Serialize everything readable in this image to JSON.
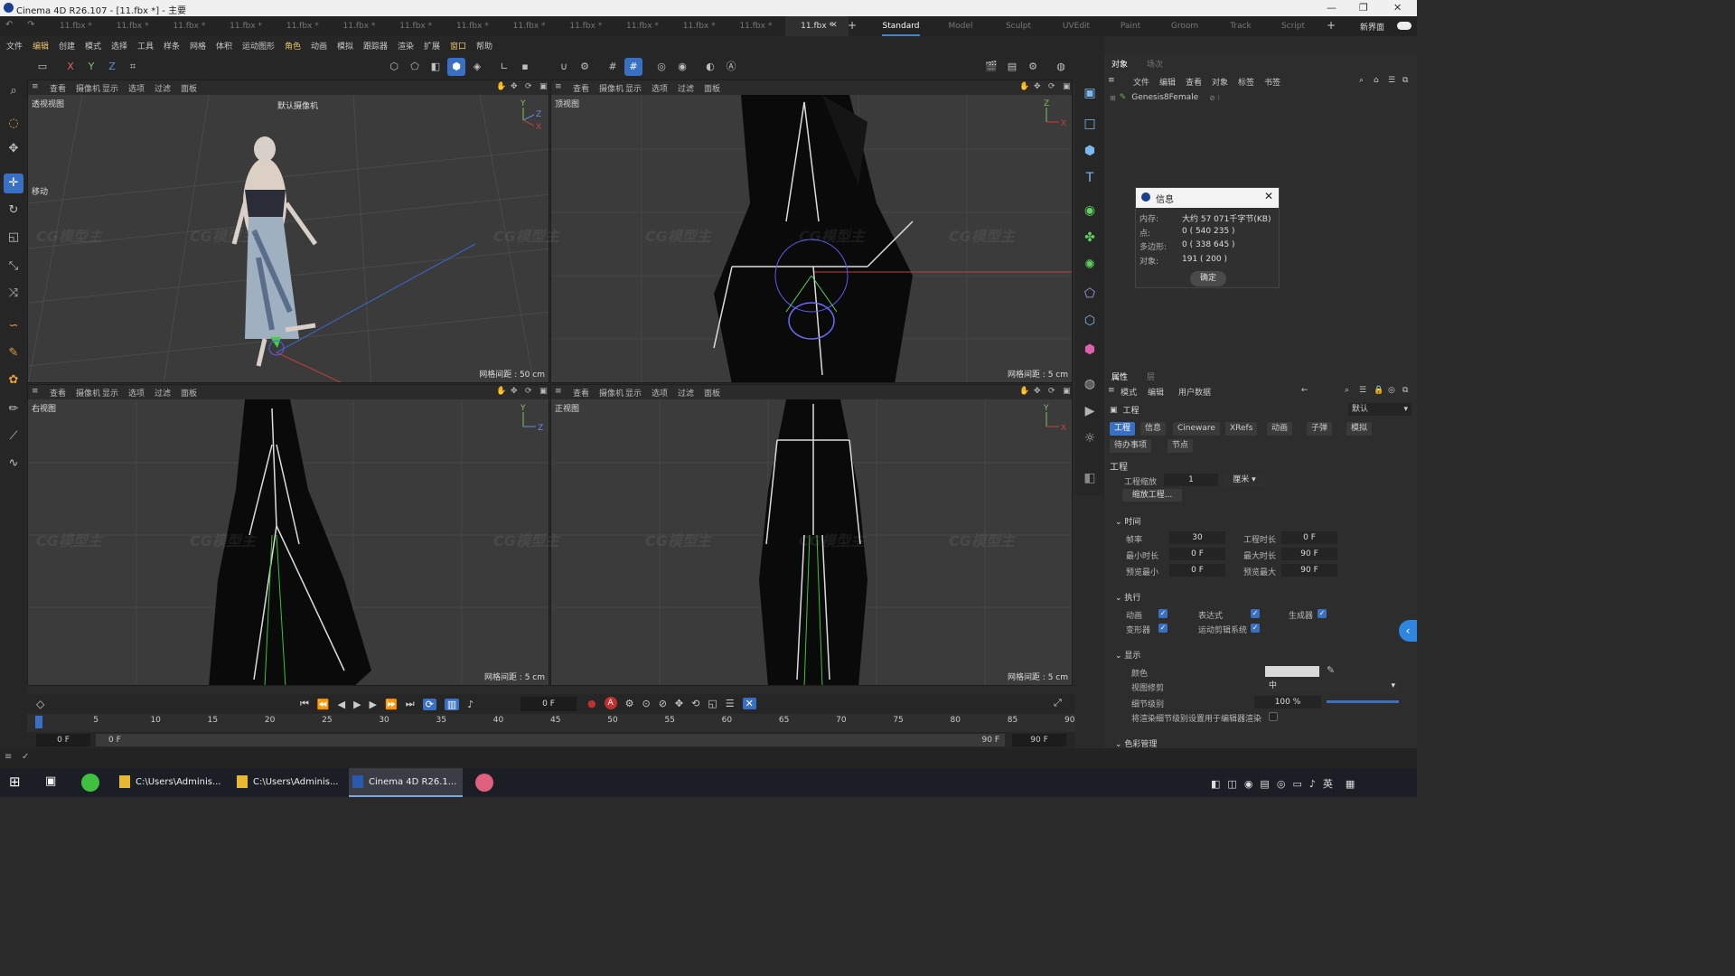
{
  "window": {
    "title": "Cinema 4D R26.107 - [11.fbx *] - 主要",
    "controls": [
      "—",
      "❐",
      "✕"
    ]
  },
  "doc_tabs": [
    "11.fbx *",
    "11.fbx *",
    "11.fbx *",
    "11.fbx *",
    "11.fbx *",
    "11.fbx *",
    "11.fbx *",
    "11.fbx *",
    "11.fbx *",
    "11.fbx *",
    "11.fbx *",
    "11.fbx *",
    "11.fbx *",
    "11.fbx *"
  ],
  "active_doc_tab": "11.fbx *",
  "layout_tabs": [
    "Standard",
    "Model",
    "Sculpt",
    "UVEdit",
    "Paint",
    "Groom",
    "Track",
    "Script"
  ],
  "active_layout": "Standard",
  "new_layout_label": "新界面",
  "menu": [
    "文件",
    "编辑",
    "创建",
    "模式",
    "选择",
    "工具",
    "样条",
    "网格",
    "体积",
    "运动图形",
    "角色",
    "动画",
    "模拟",
    "跟踪器",
    "渲染",
    "扩展",
    "窗口",
    "帮助"
  ],
  "toolbar_axes": [
    "X",
    "Y",
    "Z"
  ],
  "viewport_menu": [
    "查看",
    "摄像机",
    "显示",
    "选项",
    "过滤",
    "面板"
  ],
  "viewports": [
    {
      "title": "透视视图",
      "grid": "网格间距 : 50 cm",
      "camera": "默认摄像机",
      "move_label": "移动"
    },
    {
      "title": "顶视图",
      "grid": "网格间距 : 5 cm"
    },
    {
      "title": "右视图",
      "grid": "网格间距 : 5 cm"
    },
    {
      "title": "正视图",
      "grid": "网格间距 : 5 cm"
    }
  ],
  "object_panel": {
    "tabs": [
      "对象",
      "场次"
    ],
    "menu": [
      "文件",
      "编辑",
      "查看",
      "对象",
      "标签",
      "书签"
    ],
    "object": "Genesis8Female"
  },
  "info_dialog": {
    "title": "信息",
    "rows": [
      {
        "k": "内存:",
        "v": "大约 57 071千字节(KB)"
      },
      {
        "k": "点:",
        "v": "0 ( 540 235 )"
      },
      {
        "k": "多边形:",
        "v": "0 ( 338 645 )"
      },
      {
        "k": "对象:",
        "v": "191 ( 200 )"
      }
    ],
    "ok": "确定"
  },
  "attr_panel": {
    "tabs": [
      "属性",
      "层"
    ],
    "menu": [
      "模式",
      "编辑",
      "用户数据"
    ],
    "header": "工程",
    "preset": "默认",
    "subtabs": [
      "工程",
      "信息",
      "Cineware",
      "XRefs",
      "动画",
      "子弹",
      "模拟"
    ],
    "subtabs2": [
      "待办事项",
      "节点"
    ],
    "section_title": "工程",
    "scale_label": "工程缩放",
    "scale_value": "1",
    "scale_unit": "厘米",
    "scale_btn": "缩放工程...",
    "time_section": "时间",
    "fps_label": "帧率",
    "fps_value": "30",
    "proj_len_label": "工程时长",
    "proj_len_value": "0 F",
    "min_len_label": "最小时长",
    "min_len_value": "0 F",
    "max_len_label": "最大时长",
    "max_len_value": "90 F",
    "prev_min_label": "预览最小",
    "prev_min_value": "0 F",
    "prev_max_label": "预览最大",
    "prev_max_value": "90 F",
    "exec_section": "执行",
    "exec": [
      {
        "label": "动画",
        "on": true
      },
      {
        "label": "表达式",
        "on": true
      },
      {
        "label": "生成器",
        "on": true
      },
      {
        "label": "变形器",
        "on": true
      },
      {
        "label": "运动剪辑系统",
        "on": true
      }
    ],
    "display_section": "显示",
    "color_label": "颜色",
    "clip_label": "视图修剪",
    "clip_value": "中",
    "lod_label": "细节级别",
    "lod_value": "100 %",
    "lod_fraction": 1.0,
    "render_lod_label": "将渲染细节级别设置用于编辑器渲染",
    "color_section": "色彩管理"
  },
  "timeline": {
    "current_frame": "0 F",
    "ticks": [
      "0",
      "5",
      "10",
      "15",
      "20",
      "25",
      "30",
      "35",
      "40",
      "45",
      "50",
      "55",
      "60",
      "65",
      "70",
      "75",
      "80",
      "85",
      "90"
    ],
    "range_start": "0 F",
    "range_start2": "0 F",
    "range_end": "90 F",
    "range_end2": "90 F"
  },
  "taskbar": {
    "items": [
      {
        "label": "C:\\Users\\Adminis...",
        "active": false
      },
      {
        "label": "C:\\Users\\Adminis...",
        "active": false
      },
      {
        "label": "Cinema 4D R26.1...",
        "active": true
      }
    ],
    "ime": "英"
  },
  "colors": {
    "accent": "#3a70c4",
    "bg": "#2a2a2a",
    "viewport": "#3b3b3b"
  }
}
